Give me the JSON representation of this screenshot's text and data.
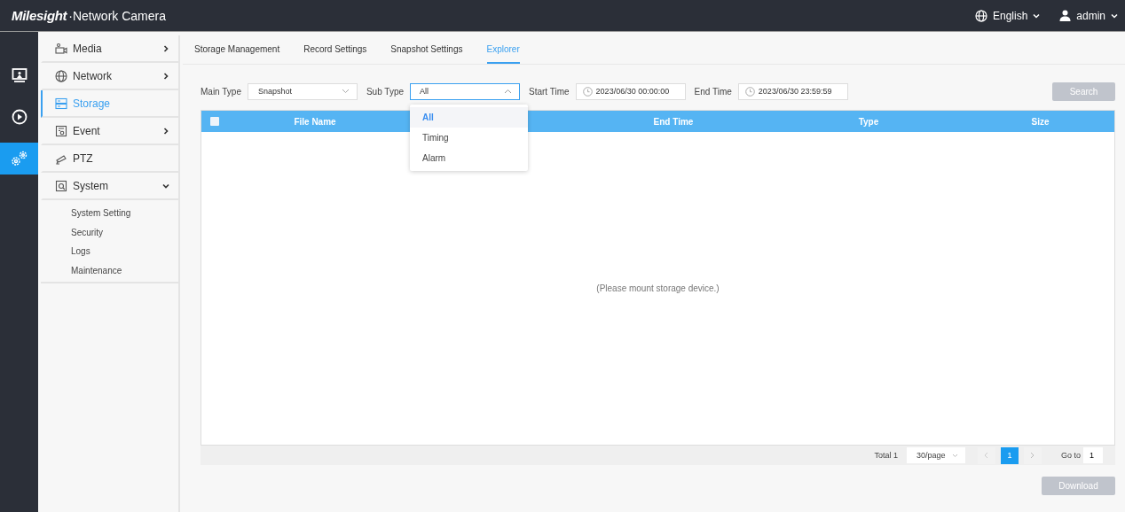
{
  "header": {
    "logo": "Milesight",
    "product": "·Network Camera",
    "language": "English",
    "user": "admin"
  },
  "rail": [
    {
      "kind": "live",
      "selected": false
    },
    {
      "kind": "playback",
      "selected": false
    },
    {
      "kind": "settings",
      "selected": true
    }
  ],
  "menu": [
    {
      "label": "Media",
      "kind": "media",
      "selected": false,
      "expanded": false,
      "arrow": true
    },
    {
      "label": "Network",
      "kind": "network",
      "selected": false,
      "expanded": false,
      "arrow": true
    },
    {
      "label": "Storage",
      "kind": "storage",
      "selected": true,
      "expanded": false,
      "arrow": false
    },
    {
      "label": "Event",
      "kind": "event",
      "selected": false,
      "expanded": false,
      "arrow": true
    },
    {
      "label": "PTZ",
      "kind": "ptz",
      "selected": false,
      "expanded": false,
      "arrow": false
    },
    {
      "label": "System",
      "kind": "system",
      "selected": false,
      "expanded": true,
      "arrow": true,
      "children": [
        "System Setting",
        "Security",
        "Logs",
        "Maintenance"
      ]
    }
  ],
  "tabs": [
    {
      "label": "Storage Management",
      "selected": false
    },
    {
      "label": "Record Settings",
      "selected": false
    },
    {
      "label": "Snapshot Settings",
      "selected": false
    },
    {
      "label": "Explorer",
      "selected": true
    }
  ],
  "filters": {
    "main_type_label": "Main Type",
    "main_type": "Snapshot",
    "sub_type_label": "Sub Type",
    "sub_type": "All",
    "start_label": "Start Time",
    "start": "2023/06/30 00:00:00",
    "end_label": "End Time",
    "end": "2023/06/30 23:59:59",
    "search": "Search"
  },
  "dropdown": {
    "expanded": true,
    "options": [
      {
        "label": "All",
        "selected": true
      },
      {
        "label": "Timing",
        "selected": false
      },
      {
        "label": "Alarm",
        "selected": false
      }
    ]
  },
  "table": {
    "checked": false,
    "columns": [
      "File Name",
      "End Time",
      "Type",
      "Size"
    ],
    "empty": "(Please mount storage device.)"
  },
  "pagination": {
    "total": "Total 1",
    "per_page": "30/page",
    "pages": [
      {
        "label": "1",
        "selected": true
      }
    ],
    "goto_label": "Go to",
    "goto": "1"
  },
  "download": "Download"
}
